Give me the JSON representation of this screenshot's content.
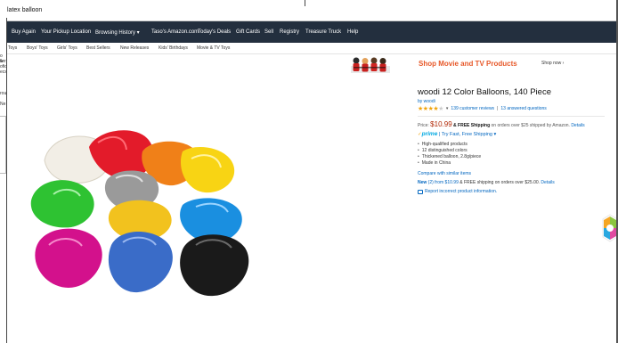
{
  "search": {
    "query": "latex balloon"
  },
  "left_fragments": [
    "o w",
    "ller",
    "ofic",
    "ecs",
    "rou",
    "Ne"
  ],
  "nav_main": [
    "Buy Again",
    "Your Pickup Location",
    "Browsing History ▾",
    "Taso's Amazon.com",
    "Today's Deals",
    "Gift Cards",
    "Sell",
    "Registry",
    "Treasure Truck",
    "Help"
  ],
  "nav_sub": [
    "Toys",
    "Boys' Toys",
    "Girls' Toys",
    "Best Sellers",
    "New Releases",
    "Kids' Birthdays",
    "Movie & TV Toys"
  ],
  "banner": {
    "title": "Shop Movie and TV Products",
    "shop_now": "Shop now ›"
  },
  "product": {
    "title": "woodi 12 Color Balloons, 140 Piece",
    "brand": "by woodi",
    "rating": 4,
    "rating_max": 5,
    "reviews": "139 customer reviews",
    "questions": "13 answered questions",
    "price_label": "Price:",
    "price": "$10.99",
    "free_shipping": "& FREE Shipping",
    "shipping_note": "on orders over $25 shipped by Amazon.",
    "details_link": "Details",
    "prime": "prime",
    "prime_note": "| Try Fast, Free Shipping ▾",
    "bullets": [
      "High-qualified products",
      "12 distinguished colors",
      "Thickened balloon, 2.8g/piece",
      "Made in China"
    ],
    "compare": "Compare with similar items",
    "new_label": "New",
    "new_offer": "(2) from $10.99",
    "new_note": "& FREE shipping on orders over $25.00.",
    "new_details": "Details",
    "report": "Report incorrect product information."
  },
  "balloon_colors": [
    "#f2eee6",
    "#e31b2a",
    "#f08018",
    "#f8d414",
    "#9a9a9a",
    "#2a6fd1",
    "#2ec232",
    "#f2c21e",
    "#1a8fe0",
    "#d3118c",
    "#3a6cc8",
    "#1a1a1a"
  ]
}
